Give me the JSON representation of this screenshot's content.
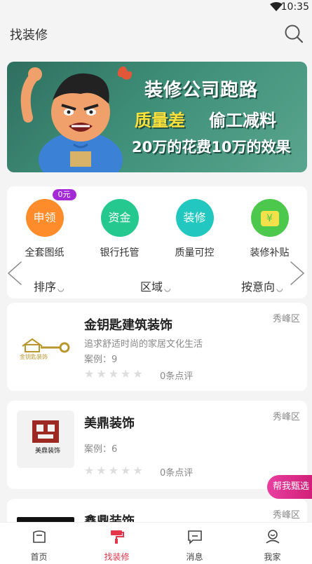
{
  "status": {
    "time": "10:35"
  },
  "header": {
    "title": "找装修"
  },
  "banner": {
    "line1": "装修公司跑路",
    "line2a": "质量差",
    "line2b": "偷工减料",
    "line3": "20万的花费10万的效果"
  },
  "menu": [
    {
      "label": "全套图纸",
      "icon_text": "申领",
      "badge": "0元",
      "color": "#ff8c2a"
    },
    {
      "label": "银行托管",
      "icon_text": "资金",
      "color": "#25c98f"
    },
    {
      "label": "质量可控",
      "icon_text": "装修",
      "color": "#22c8c0"
    },
    {
      "label": "装修补贴",
      "icon_text": "¥",
      "color": "#4cc94d"
    }
  ],
  "sort": {
    "order": "排序",
    "area": "区域",
    "intent": "按意向"
  },
  "companies": [
    {
      "name": "金钥匙建筑装饰",
      "logo_text": "金钥匙装饰",
      "slogan": "追求舒适时尚的家居文化生活",
      "cases": "案例：9",
      "reviews": "0条点评",
      "region": "秀峰区"
    },
    {
      "name": "美鼎装饰",
      "logo_text": "美鼎装饰",
      "cases": "案例：6",
      "reviews": "0条点评",
      "region": "秀峰区"
    },
    {
      "name": "鑫鼎装饰",
      "region": "秀峰区"
    }
  ],
  "help_button": "帮我甄选",
  "tabs": [
    {
      "label": "首页"
    },
    {
      "label": "找装修"
    },
    {
      "label": "消息"
    },
    {
      "label": "我家"
    }
  ]
}
